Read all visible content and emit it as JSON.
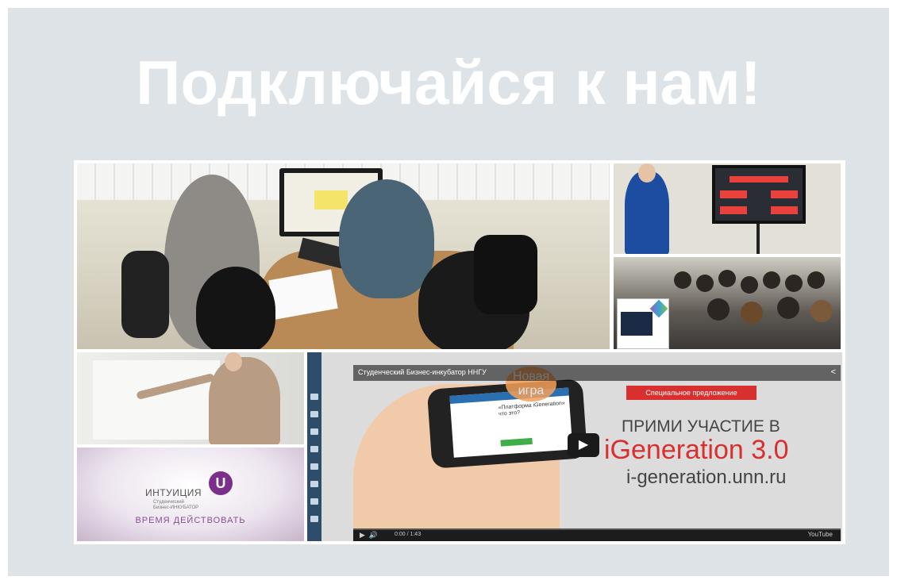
{
  "slide": {
    "title": "Подключайся к нам!"
  },
  "collage": {
    "photo5": {
      "brand": "ИНТУИЦИЯ",
      "subtitle": "Студенческий Бизнес-ИНКУБАТОР",
      "logo_letter": "U",
      "tagline": "ВРЕМЯ ДЕЙСТВОВАТЬ"
    },
    "video": {
      "title": "Студенческий Бизнес-инкубатор ННГУ",
      "new_game_badge": "Новая игра",
      "phone_question": "«Платформа iGeneration» что это?",
      "ribbon": "Специальное предложение",
      "headline": "ПРИМИ УЧАСТИЕ В",
      "program": "iGeneration 3.0",
      "url": "i-generation.unn.ru",
      "time": "0:00 / 1:43",
      "youtube_label": "YouTube"
    }
  }
}
